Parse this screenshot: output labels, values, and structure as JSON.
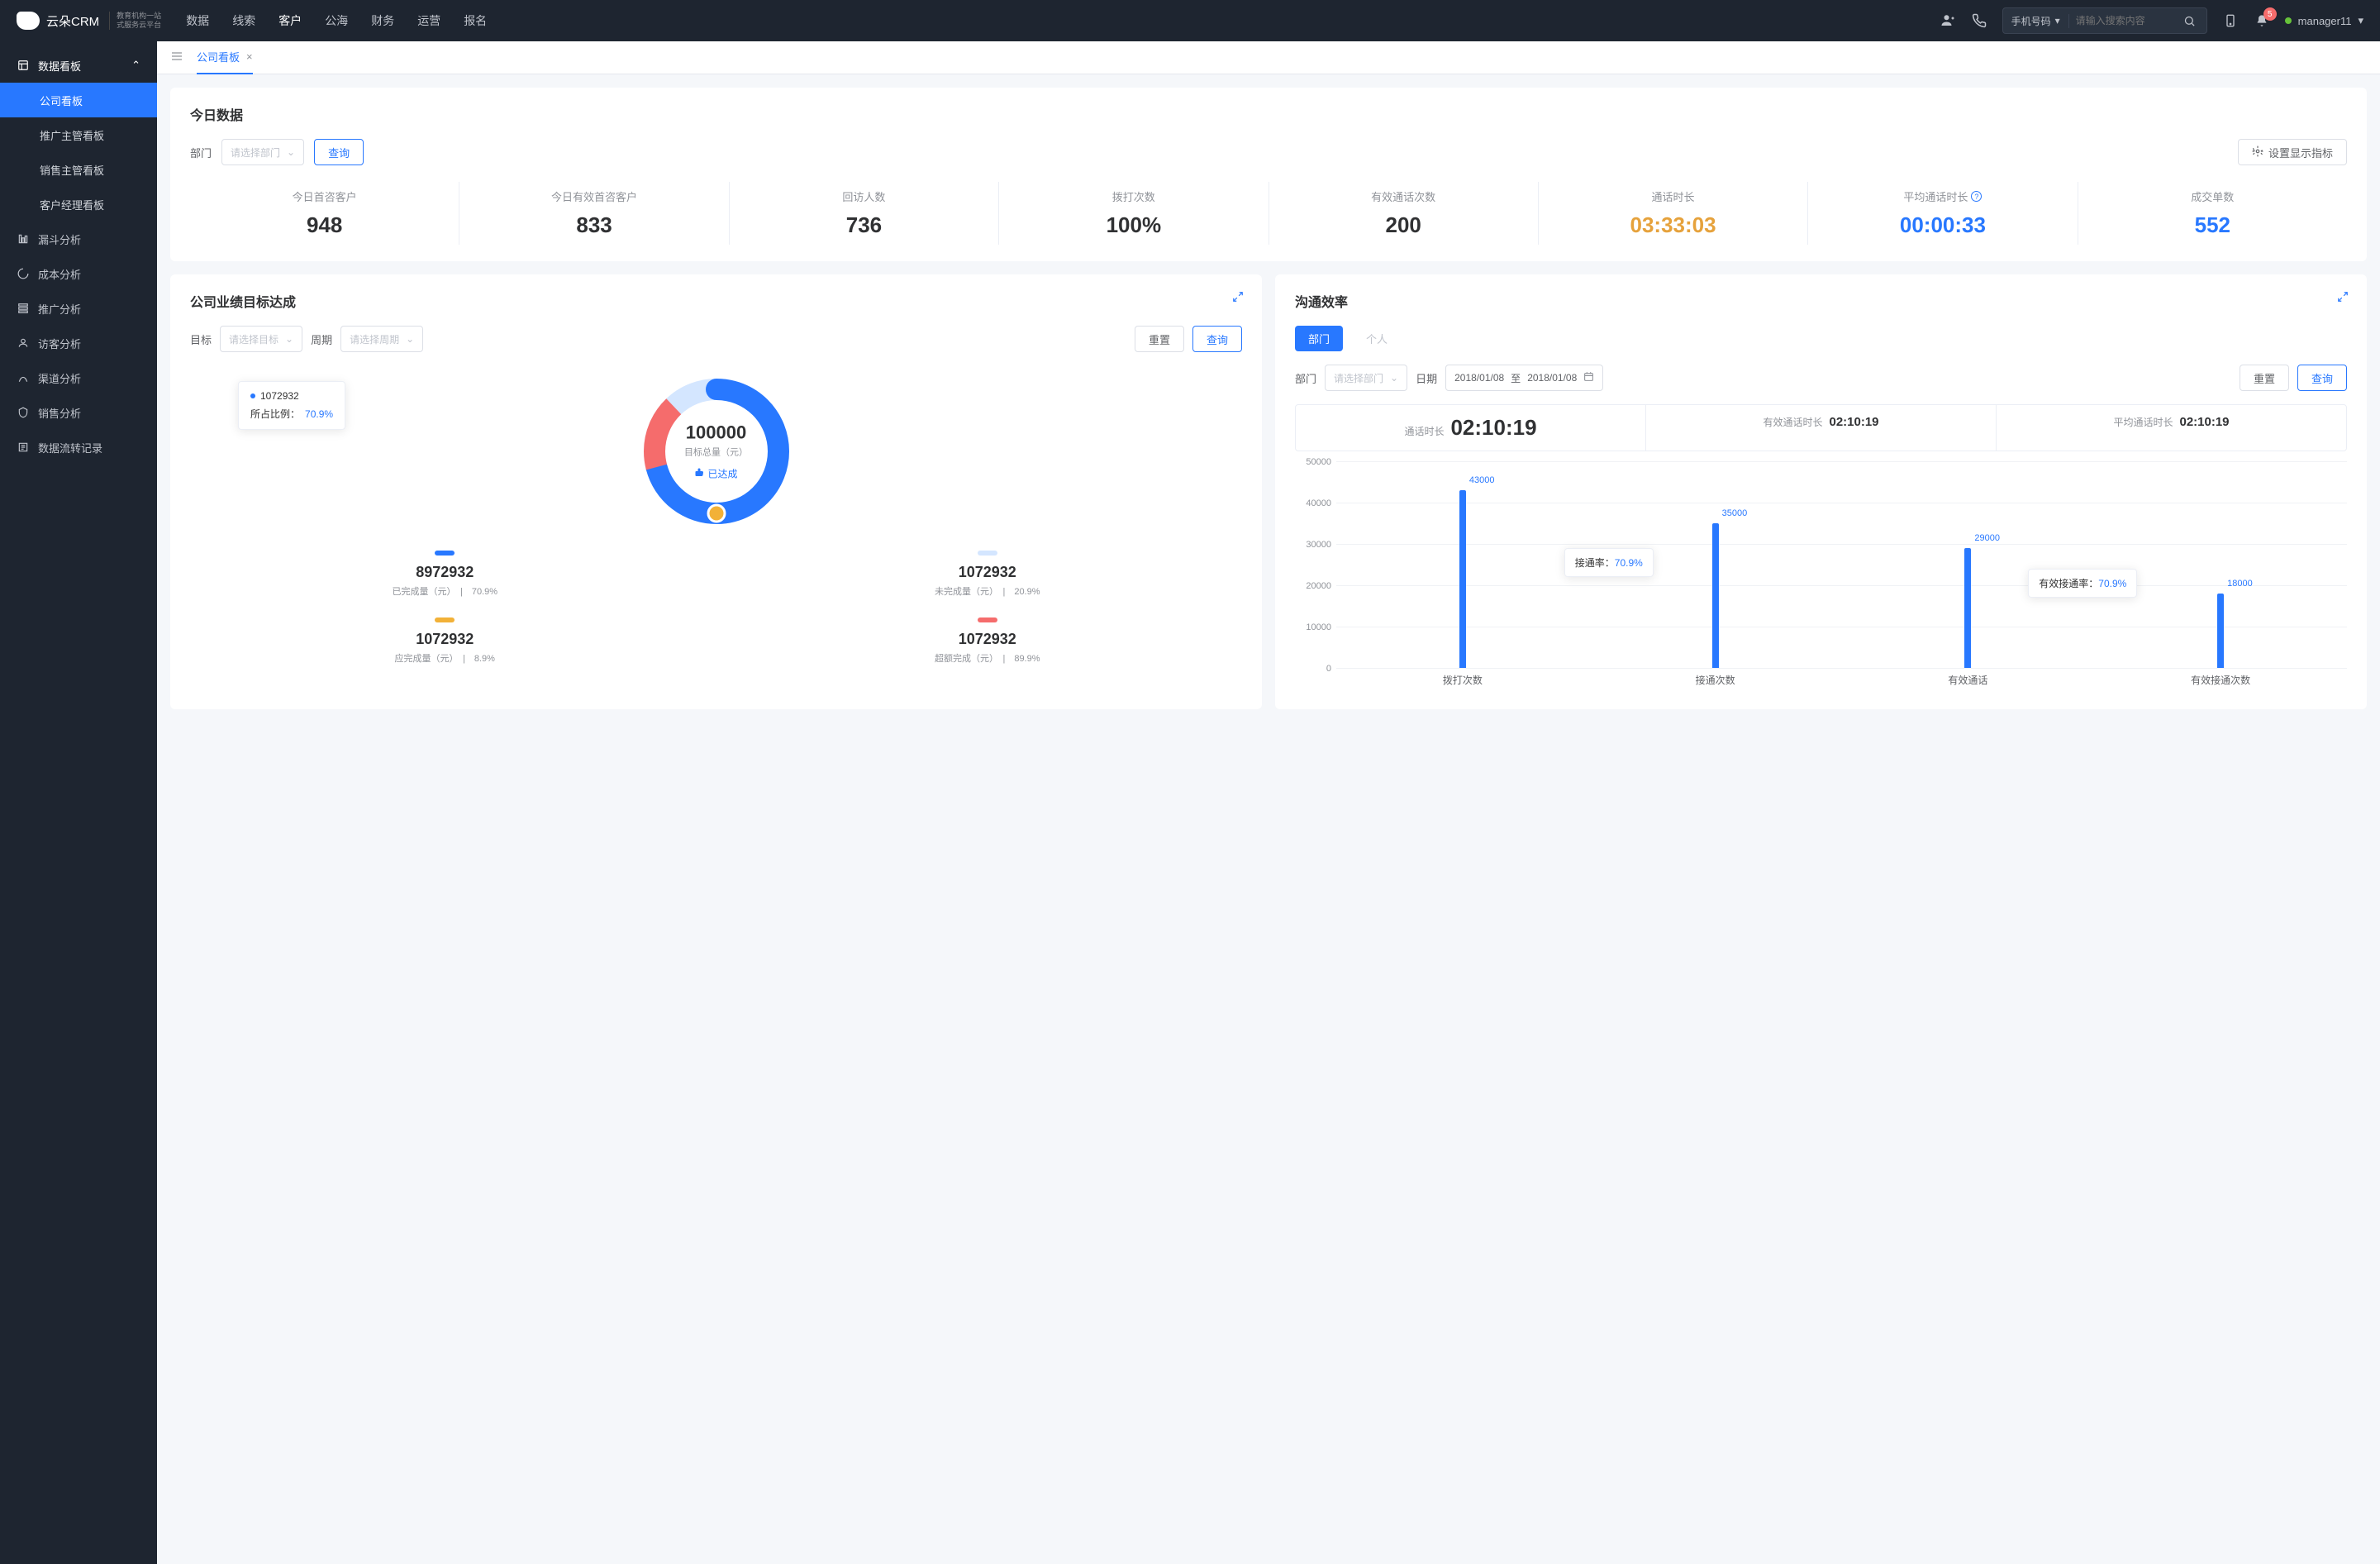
{
  "header": {
    "logo_text": "云朵CRM",
    "logo_sub1": "教育机构一站",
    "logo_sub2": "式服务云平台",
    "nav": [
      "数据",
      "线索",
      "客户",
      "公海",
      "财务",
      "运营",
      "报名"
    ],
    "nav_active_idx": 2,
    "search_type": "手机号码",
    "search_placeholder": "请输入搜索内容",
    "badge_count": "5",
    "user_name": "manager11"
  },
  "sidebar": {
    "parent_label": "数据看板",
    "children": [
      "公司看板",
      "推广主管看板",
      "销售主管看板",
      "客户经理看板"
    ],
    "active_child_idx": 0,
    "items": [
      "漏斗分析",
      "成本分析",
      "推广分析",
      "访客分析",
      "渠道分析",
      "销售分析",
      "数据流转记录"
    ]
  },
  "tabs": {
    "active": "公司看板"
  },
  "today": {
    "title": "今日数据",
    "dept_label": "部门",
    "dept_placeholder": "请选择部门",
    "query_btn": "查询",
    "settings_btn": "设置显示指标",
    "kpis": [
      {
        "label": "今日首咨客户",
        "value": "948",
        "color": "#303133"
      },
      {
        "label": "今日有效首咨客户",
        "value": "833",
        "color": "#303133"
      },
      {
        "label": "回访人数",
        "value": "736",
        "color": "#303133"
      },
      {
        "label": "拨打次数",
        "value": "100%",
        "color": "#303133"
      },
      {
        "label": "有效通话次数",
        "value": "200",
        "color": "#303133"
      },
      {
        "label": "通话时长",
        "value": "03:33:03",
        "color": "#e6a23c"
      },
      {
        "label": "平均通话时长",
        "value": "00:00:33",
        "color": "#2878ff",
        "help": true
      },
      {
        "label": "成交单数",
        "value": "552",
        "color": "#2878ff"
      }
    ]
  },
  "goal": {
    "title": "公司业绩目标达成",
    "target_label": "目标",
    "target_placeholder": "请选择目标",
    "period_label": "周期",
    "period_placeholder": "请选择周期",
    "reset_btn": "重置",
    "query_btn": "查询",
    "donut_center_value": "100000",
    "donut_center_label": "目标总量（元）",
    "donut_badge": "已达成",
    "tooltip_value": "1072932",
    "tooltip_ratio_label": "所占比例：",
    "tooltip_ratio": "70.9%",
    "legend": [
      {
        "color": "#2878ff",
        "val": "8972932",
        "desc": "已完成量（元）",
        "pct": "70.9%"
      },
      {
        "color": "#d4e6ff",
        "val": "1072932",
        "desc": "未完成量（元）",
        "pct": "20.9%"
      },
      {
        "color": "#f2b138",
        "val": "1072932",
        "desc": "应完成量（元）",
        "pct": "8.9%"
      },
      {
        "color": "#f56c6c",
        "val": "1072932",
        "desc": "超额完成（元）",
        "pct": "89.9%"
      }
    ]
  },
  "comm": {
    "title": "沟通效率",
    "seg_dept": "部门",
    "seg_person": "个人",
    "dept_label": "部门",
    "dept_placeholder": "请选择部门",
    "date_label": "日期",
    "date_from": "2018/01/08",
    "date_to_label": "至",
    "date_to": "2018/01/08",
    "reset_btn": "重置",
    "query_btn": "查询",
    "durations": [
      {
        "label": "通话时长",
        "value": "02:10:19",
        "big": true
      },
      {
        "label": "有效通话时长",
        "value": "02:10:19"
      },
      {
        "label": "平均通话时长",
        "value": "02:10:19"
      }
    ],
    "tooltip1_label": "接通率：",
    "tooltip1_value": "70.9%",
    "tooltip2_label": "有效接通率：",
    "tooltip2_value": "70.9%"
  },
  "chart_data": [
    {
      "type": "pie",
      "title": "公司业绩目标达成",
      "series": [
        {
          "name": "已完成量（元）",
          "value": 8972932,
          "percent": 70.9,
          "color": "#2878ff"
        },
        {
          "name": "未完成量（元）",
          "value": 1072932,
          "percent": 20.9,
          "color": "#d4e6ff"
        },
        {
          "name": "应完成量（元）",
          "value": 1072932,
          "percent": 8.9,
          "color": "#f2b138"
        },
        {
          "name": "超额完成（元）",
          "value": 1072932,
          "percent": 89.9,
          "color": "#f56c6c"
        }
      ],
      "center_value": 100000,
      "center_label": "目标总量（元）"
    },
    {
      "type": "bar",
      "title": "沟通效率",
      "categories": [
        "拨打次数",
        "接通次数",
        "有效通话",
        "有效接通次数"
      ],
      "values": [
        43000,
        35000,
        29000,
        18000
      ],
      "ylabel": "",
      "ylim": [
        0,
        50000
      ],
      "yticks": [
        0,
        10000,
        20000,
        30000,
        40000,
        50000
      ]
    }
  ]
}
